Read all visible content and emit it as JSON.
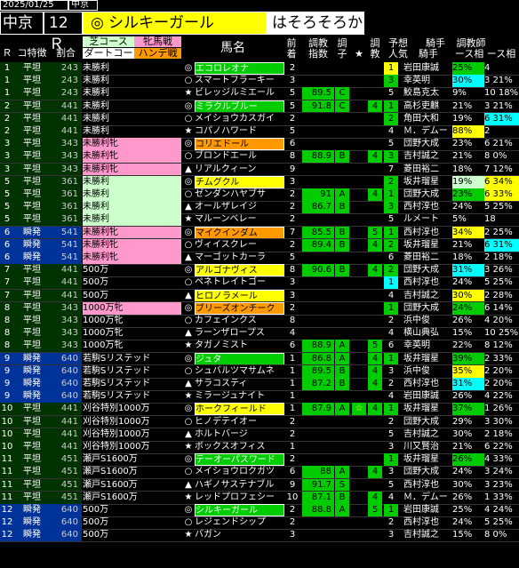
{
  "header": {
    "date": "2025/01/25",
    "venue_small": "中京",
    "venue": "中京",
    "race_no": "12Ｒ",
    "pick_mark": "◎",
    "pick_name": "シルキーガール",
    "comment": "はそろそろか"
  },
  "columns": {
    "r": "Ｒ",
    "track": "コ特徴",
    "ratio": "割合",
    "course_top": "芝コース",
    "course_bot": "ダートコー",
    "hn_top": "牝馬戦",
    "hn_bot": "ハンデ戦",
    "name": "馬名",
    "zen_top": "前",
    "zen_bot": "着",
    "idx_top": "調教",
    "idx_bot": "指数",
    "cho_top": "調",
    "cho_bot": "子",
    "star": "★",
    "kyo_top": "調",
    "kyo_bot": "教",
    "yoso_top": "予想",
    "yoso_bot": "人気",
    "kishu_top": "騎手",
    "kishu_bot": "騎手",
    "chokyo_top": "調教師",
    "chokyo_bot": "ース相 ース相"
  },
  "colors": {
    "green": "#00cc00",
    "yellow": "#ffff00",
    "cyan": "#00ffff",
    "pink": "#ff99cc",
    "orange": "#ff9900",
    "bgPrime": "#003399"
  },
  "rows": [
    {
      "r": "1",
      "t": "平坦",
      "p": "243",
      "race": "未勝利",
      "rc": "",
      "mark": "◎",
      "mt": "box",
      "name": "エコロレオナ",
      "nc": "#00cc00",
      "z": "2",
      "idx": "",
      "cho": "",
      "st": "",
      "kyo": "",
      "yo": "1",
      "yc": "#ffff00",
      "jk": "岩田康誠",
      "pct1": "25%",
      "c1": "#00cc00",
      "pct2": "4",
      "c2": ""
    },
    {
      "r": "1",
      "t": "平坦",
      "p": "243",
      "race": "未勝利",
      "rc": "",
      "mark": "○",
      "mt": "",
      "name": "スマートフラーキー",
      "nc": "",
      "z": "3",
      "idx": "",
      "cho": "",
      "st": "",
      "kyo": "",
      "yo": "3",
      "yc": "#00cc00",
      "jk": "幸英明",
      "pct1": "30%",
      "c1": "#00ffff",
      "pct2": "3 21%",
      "c2": ""
    },
    {
      "r": "1",
      "t": "平坦",
      "p": "243",
      "race": "未勝利",
      "rc": "",
      "mark": "★",
      "mt": "",
      "name": "ビレッジルミエール",
      "nc": "",
      "z": "5",
      "idx": "89.5",
      "cho": "C",
      "st": "",
      "kyo": "",
      "yo": "5",
      "yc": "",
      "jk": "鮫島克太",
      "pct1": "9%",
      "c1": "",
      "pct2": "10 18%",
      "c2": ""
    },
    {
      "r": "2",
      "t": "平坦",
      "p": "441",
      "race": "未勝利",
      "rc": "",
      "mark": "◎",
      "mt": "box",
      "name": "ミラクルブルー",
      "nc": "#00cc00",
      "z": "5",
      "idx": "91.8",
      "cho": "C",
      "st": "",
      "kyo": "4",
      "yo": "1",
      "yc": "#00cc00",
      "jk": "高杉吏麒",
      "pct1": "21%",
      "c1": "",
      "pct2": "3 21%",
      "c2": ""
    },
    {
      "r": "2",
      "t": "平坦",
      "p": "441",
      "race": "未勝利",
      "rc": "",
      "mark": "○",
      "mt": "",
      "name": "メイショウカスガイ",
      "nc": "",
      "z": "2",
      "idx": "",
      "cho": "",
      "st": "",
      "kyo": "",
      "yo": "2",
      "yc": "#00cc00",
      "jk": "角田大和",
      "pct1": "19%",
      "c1": "",
      "pct2": "6 31%",
      "c2": "#00ffff"
    },
    {
      "r": "2",
      "t": "平坦",
      "p": "441",
      "race": "未勝利",
      "rc": "",
      "mark": "★",
      "mt": "",
      "name": "コパノハワード",
      "nc": "",
      "z": "5",
      "idx": "",
      "cho": "",
      "st": "",
      "kyo": "",
      "yo": "4",
      "yc": "",
      "jk": "Ｍ．デムー",
      "pct1": "88%",
      "c1": "#ffff00",
      "pct2": "2 ",
      "c2": ""
    },
    {
      "r": "3",
      "t": "平坦",
      "p": "343",
      "race": "未勝利牝",
      "rc": "#ff99cc",
      "mark": "◎",
      "mt": "box",
      "name": "コリエドール",
      "nc": "#ff9900",
      "z": "6",
      "idx": "",
      "cho": "",
      "st": "",
      "kyo": "",
      "yo": "5",
      "yc": "",
      "jk": "団野大成",
      "pct1": "23%",
      "c1": "",
      "pct2": "6 21%",
      "c2": ""
    },
    {
      "r": "3",
      "t": "平坦",
      "p": "343",
      "race": "未勝利牝",
      "rc": "#ff99cc",
      "mark": "○",
      "mt": "",
      "name": "ブロンドエール",
      "nc": "",
      "z": "8",
      "idx": "88.9",
      "cho": "B",
      "st": "",
      "kyo": "4",
      "yo": "3",
      "yc": "#00cc00",
      "jk": "吉村誠之",
      "pct1": "21%",
      "c1": "",
      "pct2": "8 0%",
      "c2": ""
    },
    {
      "r": "3",
      "t": "平坦",
      "p": "343",
      "race": "未勝利牝",
      "rc": "#ff99cc",
      "mark": "▲",
      "mt": "",
      "name": "リアルクィーン",
      "nc": "",
      "z": "9",
      "idx": "",
      "cho": "",
      "st": "",
      "kyo": "",
      "yo": "7",
      "yc": "",
      "jk": "菱田裕二",
      "pct1": "18%",
      "c1": "",
      "pct2": "7 12%",
      "c2": ""
    },
    {
      "r": "5",
      "t": "平坦",
      "p": "361",
      "race": "未勝利",
      "rc": "#ccffcc",
      "mark": "◎",
      "mt": "box",
      "name": "チムグクル",
      "nc": "#ffff00",
      "z": "3",
      "idx": "",
      "cho": "",
      "st": "",
      "kyo": "",
      "yo": "2",
      "yc": "#00cc00",
      "jk": "坂井瑠星",
      "pct1": "19%",
      "c1": "#ccffcc",
      "pct2": "6 34%",
      "c2": "#ffff00"
    },
    {
      "r": "5",
      "t": "平坦",
      "p": "361",
      "race": "未勝利",
      "rc": "#ccffcc",
      "mark": "○",
      "mt": "",
      "name": "ゼンダンハヤブサ",
      "nc": "",
      "z": "2",
      "idx": "91",
      "cho": "A",
      "st": "",
      "kyo": "4",
      "yo": "1",
      "yc": "#00cc00",
      "jk": "団野大成",
      "pct1": "23%",
      "c1": "#00cc00",
      "pct2": "6 33%",
      "c2": "#ffff00"
    },
    {
      "r": "5",
      "t": "平坦",
      "p": "361",
      "race": "未勝利",
      "rc": "#ccffcc",
      "mark": "▲",
      "mt": "",
      "name": "オールザレイジ",
      "nc": "",
      "z": "2",
      "idx": "86.7",
      "cho": "B",
      "st": "",
      "kyo": "",
      "yo": "3",
      "yc": "#00cc00",
      "jk": "西村淳也",
      "pct1": "24%",
      "c1": "",
      "pct2": "5 25%",
      "c2": ""
    },
    {
      "r": "5",
      "t": "平坦",
      "p": "361",
      "race": "未勝利",
      "rc": "#ccffcc",
      "mark": "★",
      "mt": "",
      "name": "マルーンベレー",
      "nc": "",
      "z": "2",
      "idx": "",
      "cho": "",
      "st": "",
      "kyo": "",
      "yo": "5",
      "yc": "",
      "jk": "ルメート",
      "pct1": "5%",
      "c1": "",
      "pct2": "18 ",
      "c2": ""
    },
    {
      "r": "6",
      "t": "瞬発",
      "p": "541",
      "race": "未勝利牝",
      "rc": "#ff99cc",
      "mark": "◎",
      "mt": "box",
      "name": "マイクインダム",
      "nc": "#ff9900",
      "z": "7",
      "idx": "85.5",
      "cho": "B",
      "st": "",
      "kyo": "5",
      "yo": "1",
      "yc": "#00cc00",
      "jk": "西村淳也",
      "pct1": "34%",
      "c1": "#ffff00",
      "pct2": "2 25%",
      "c2": ""
    },
    {
      "r": "6",
      "t": "瞬発",
      "p": "541",
      "race": "未勝利牝",
      "rc": "#ff99cc",
      "mark": "○",
      "mt": "",
      "name": "ヴィイスクレー",
      "nc": "",
      "z": "2",
      "idx": "89.4",
      "cho": "B",
      "st": "",
      "kyo": "4",
      "yo": "2",
      "yc": "#00cc00",
      "jk": "坂井瑠星",
      "pct1": "21%",
      "c1": "",
      "pct2": "6 31%",
      "c2": "#00ffff"
    },
    {
      "r": "6",
      "t": "瞬発",
      "p": "541",
      "race": "未勝利牝",
      "rc": "#ff99cc",
      "mark": "▲",
      "mt": "",
      "name": "マーゴットカーラ",
      "nc": "",
      "z": "5",
      "idx": "",
      "cho": "",
      "st": "",
      "kyo": "",
      "yo": "6",
      "yc": "",
      "jk": "菱田裕二",
      "pct1": "18%",
      "c1": "",
      "pct2": "2 18%",
      "c2": ""
    },
    {
      "r": "7",
      "t": "平坦",
      "p": "441",
      "race": "500万",
      "rc": "",
      "mark": "◎",
      "mt": "box",
      "name": "アルゴナヴィス",
      "nc": "#ffff00",
      "z": "8",
      "idx": "90.6",
      "cho": "B",
      "st": "",
      "kyo": "4",
      "yo": "2",
      "yc": "#00cc00",
      "jk": "団野大成",
      "pct1": "31%",
      "c1": "#00ffff",
      "pct2": "3 26%",
      "c2": ""
    },
    {
      "r": "7",
      "t": "平坦",
      "p": "441",
      "race": "500万",
      "rc": "",
      "mark": "○",
      "mt": "",
      "name": "ペネトレイトゴー",
      "nc": "",
      "z": "3",
      "idx": "",
      "cho": "",
      "st": "",
      "kyo": "",
      "yo": "1",
      "yc": "#00ffff",
      "jk": "西村淳也",
      "pct1": "24%",
      "c1": "",
      "pct2": "5 25%",
      "c2": ""
    },
    {
      "r": "7",
      "t": "平坦",
      "p": "441",
      "race": "500万",
      "rc": "",
      "mark": "▲",
      "mt": "",
      "name": "ヒロノラメール",
      "nc": "#ffff00",
      "z": "3",
      "idx": "",
      "cho": "",
      "st": "",
      "kyo": "",
      "yo": "4",
      "yc": "",
      "jk": "吉村誠之",
      "pct1": "30%",
      "c1": "#ffff00",
      "pct2": "2 28%",
      "c2": ""
    },
    {
      "r": "8",
      "t": "平坦",
      "p": "343",
      "race": "1000万牝",
      "rc": "#ff99cc",
      "mark": "◎",
      "mt": "box",
      "name": "ブリーズオンチーク",
      "nc": "#ff9900",
      "z": "2",
      "idx": "",
      "cho": "",
      "st": "",
      "kyo": "",
      "yo": "1",
      "yc": "#00cc00",
      "jk": "団野大成",
      "pct1": "24%",
      "c1": "#00cc00",
      "pct2": "6 14%",
      "c2": ""
    },
    {
      "r": "8",
      "t": "平坦",
      "p": "343",
      "race": "1000万牝",
      "rc": "",
      "mark": "○",
      "mt": "",
      "name": "カフェインクス",
      "nc": "",
      "z": "8",
      "idx": "",
      "cho": "",
      "st": "",
      "kyo": "",
      "yo": "2",
      "yc": "",
      "jk": "浜中俊",
      "pct1": "26%",
      "c1": "",
      "pct2": "4 20%",
      "c2": ""
    },
    {
      "r": "8",
      "t": "平坦",
      "p": "343",
      "race": "1000万牝",
      "rc": "",
      "mark": "▲",
      "mt": "",
      "name": "ラーンザロープス",
      "nc": "",
      "z": "4",
      "idx": "",
      "cho": "",
      "st": "",
      "kyo": "",
      "yo": "4",
      "yc": "",
      "jk": "横山典弘",
      "pct1": "15%",
      "c1": "",
      "pct2": "10 25%",
      "c2": ""
    },
    {
      "r": "8",
      "t": "平坦",
      "p": "343",
      "race": "1000万牝",
      "rc": "",
      "mark": "★",
      "mt": "",
      "name": "タガノミスト",
      "nc": "",
      "z": "6",
      "idx": "88.9",
      "cho": "A",
      "st": "",
      "kyo": "5",
      "yo": "6",
      "yc": "",
      "jk": "幸英明",
      "pct1": "22%",
      "c1": "",
      "pct2": "8 12%",
      "c2": ""
    },
    {
      "r": "9",
      "t": "瞬発",
      "p": "640",
      "race": "若駒Sリステッド",
      "rc": "",
      "mark": "◎",
      "mt": "box",
      "name": "ジュタ",
      "nc": "#00cc00",
      "z": "1",
      "idx": "86.8",
      "cho": "A",
      "st": "",
      "kyo": "4",
      "yo": "1",
      "yc": "#00cc00",
      "jk": "坂井瑠星",
      "pct1": "39%",
      "c1": "#00cc00",
      "pct2": "2 33%",
      "c2": ""
    },
    {
      "r": "9",
      "t": "瞬発",
      "p": "640",
      "race": "若駒Sリステッド",
      "rc": "",
      "mark": "○",
      "mt": "",
      "name": "シュバルツマサムネ",
      "nc": "",
      "z": "1",
      "idx": "89.5",
      "cho": "B",
      "st": "",
      "kyo": "4",
      "yo": "3",
      "yc": "",
      "jk": "浜中俊",
      "pct1": "35%",
      "c1": "#ffff00",
      "pct2": "2 20%",
      "c2": ""
    },
    {
      "r": "9",
      "t": "瞬発",
      "p": "640",
      "race": "若駒Sリステッド",
      "rc": "",
      "mark": "▲",
      "mt": "",
      "name": "サラコスティ",
      "nc": "",
      "z": "1",
      "idx": "87.2",
      "cho": "B",
      "st": "",
      "kyo": "4",
      "yo": "2",
      "yc": "",
      "jk": "西村淳也",
      "pct1": "31%",
      "c1": "#00ffff",
      "pct2": "2 20%",
      "c2": ""
    },
    {
      "r": "9",
      "t": "瞬発",
      "p": "640",
      "race": "若駒Sリステッド",
      "rc": "",
      "mark": "★",
      "mt": "",
      "name": "ミラージュナイト",
      "nc": "",
      "z": "1",
      "idx": "",
      "cho": "",
      "st": "",
      "kyo": "",
      "yo": "4",
      "yc": "",
      "jk": "岩田康誠",
      "pct1": "26%",
      "c1": "",
      "pct2": "4 22%",
      "c2": ""
    },
    {
      "r": "10",
      "t": "平坦",
      "p": "441",
      "race": "刈谷特別1000万",
      "rc": "",
      "mark": "◎",
      "mt": "box",
      "name": "ホークフィールド",
      "nc": "#ffff00",
      "z": "1",
      "idx": "87.9",
      "cho": "A",
      "st": "☆",
      "kyo": "4",
      "yo": "1",
      "yc": "#00cc00",
      "jk": "坂井瑠星",
      "pct1": "37%",
      "c1": "#00cc00",
      "pct2": "1 26%",
      "c2": ""
    },
    {
      "r": "10",
      "t": "平坦",
      "p": "441",
      "race": "刈谷特別1000万",
      "rc": "",
      "mark": "○",
      "mt": "",
      "name": "ヒノデテイオー",
      "nc": "",
      "z": "2",
      "idx": "",
      "cho": "",
      "st": "",
      "kyo": "",
      "yo": "2",
      "yc": "",
      "jk": "団野大成",
      "pct1": "29%",
      "c1": "",
      "pct2": "3 30%",
      "c2": ""
    },
    {
      "r": "10",
      "t": "平坦",
      "p": "441",
      "race": "刈谷特別1000万",
      "rc": "",
      "mark": "▲",
      "mt": "",
      "name": "ホルトバージ",
      "nc": "",
      "z": "2",
      "idx": "",
      "cho": "",
      "st": "",
      "kyo": "",
      "yo": "5",
      "yc": "",
      "jk": "吉村誠之",
      "pct1": "30%",
      "c1": "",
      "pct2": "2 18%",
      "c2": ""
    },
    {
      "r": "10",
      "t": "平坦",
      "p": "441",
      "race": "刈谷特別1000万",
      "rc": "",
      "mark": "★",
      "mt": "",
      "name": "ボックスオフィス",
      "nc": "",
      "z": "1",
      "idx": "",
      "cho": "",
      "st": "",
      "kyo": "",
      "yo": "3",
      "yc": "",
      "jk": "川又賢治",
      "pct1": "21%",
      "c1": "",
      "pct2": "6 22%",
      "c2": ""
    },
    {
      "r": "11",
      "t": "平坦",
      "p": "451",
      "race": "瀬戸S1600万",
      "rc": "",
      "mark": "◎",
      "mt": "box",
      "name": "テーオーパスワード",
      "nc": "#00cc00",
      "z": "2",
      "idx": "",
      "cho": "",
      "st": "",
      "kyo": "",
      "yo": "1",
      "yc": "#00cc00",
      "jk": "坂井瑠星",
      "pct1": "26%",
      "c1": "#00cc00",
      "pct2": "4 33%",
      "c2": ""
    },
    {
      "r": "11",
      "t": "平坦",
      "p": "451",
      "race": "瀬戸S1600万",
      "rc": "",
      "mark": "○",
      "mt": "",
      "name": "メイショウロクガツ",
      "nc": "",
      "z": "6",
      "idx": "88",
      "cho": "A",
      "st": "",
      "kyo": "4",
      "yo": "3",
      "yc": "",
      "jk": "団野大成",
      "pct1": "24%",
      "c1": "",
      "pct2": "3 24%",
      "c2": ""
    },
    {
      "r": "11",
      "t": "平坦",
      "p": "451",
      "race": "瀬戸S1600万",
      "rc": "",
      "mark": "▲",
      "mt": "",
      "name": "ハギノサステナブル",
      "nc": "",
      "z": "9",
      "idx": "91.7",
      "cho": "S",
      "st": "",
      "kyo": "",
      "yo": "5",
      "yc": "",
      "jk": "西村淳也",
      "pct1": "30%",
      "c1": "",
      "pct2": "3 23%",
      "c2": ""
    },
    {
      "r": "11",
      "t": "平坦",
      "p": "451",
      "race": "瀬戸S1600万",
      "rc": "",
      "mark": "★",
      "mt": "",
      "name": "レッドプロフェシー",
      "nc": "",
      "z": "10",
      "idx": "87.1",
      "cho": "B",
      "st": "",
      "kyo": "4",
      "yo": "4",
      "yc": "",
      "jk": "Ｍ．デムー",
      "pct1": "26%",
      "c1": "",
      "pct2": "1 33%",
      "c2": ""
    },
    {
      "r": "12",
      "t": "瞬発",
      "p": "640",
      "race": "500万",
      "rc": "",
      "mark": "◎",
      "mt": "box",
      "name": "シルキーガール",
      "nc": "#00cc00",
      "z": "2",
      "idx": "88.8",
      "cho": "A",
      "st": "",
      "kyo": "5",
      "yo": "1",
      "yc": "#00cc00",
      "jk": "岩田康誠",
      "pct1": "25%",
      "c1": "",
      "pct2": "4 24%",
      "c2": ""
    },
    {
      "r": "12",
      "t": "瞬発",
      "p": "640",
      "race": "500万",
      "rc": "",
      "mark": "○",
      "mt": "",
      "name": "レジェンドシップ",
      "nc": "",
      "z": "2",
      "idx": "",
      "cho": "",
      "st": "",
      "kyo": "",
      "yo": "2",
      "yc": "",
      "jk": "西村淳也",
      "pct1": "24%",
      "c1": "",
      "pct2": "5 25%",
      "c2": ""
    },
    {
      "r": "12",
      "t": "瞬発",
      "p": "640",
      "race": "500万",
      "rc": "",
      "mark": "★",
      "mt": "",
      "name": "バガン",
      "nc": "",
      "z": "3",
      "idx": "",
      "cho": "",
      "st": "",
      "kyo": "",
      "yo": "3",
      "yc": "",
      "jk": "吉村誠之",
      "pct1": "15%",
      "c1": "",
      "pct2": "8 0%",
      "c2": ""
    }
  ]
}
